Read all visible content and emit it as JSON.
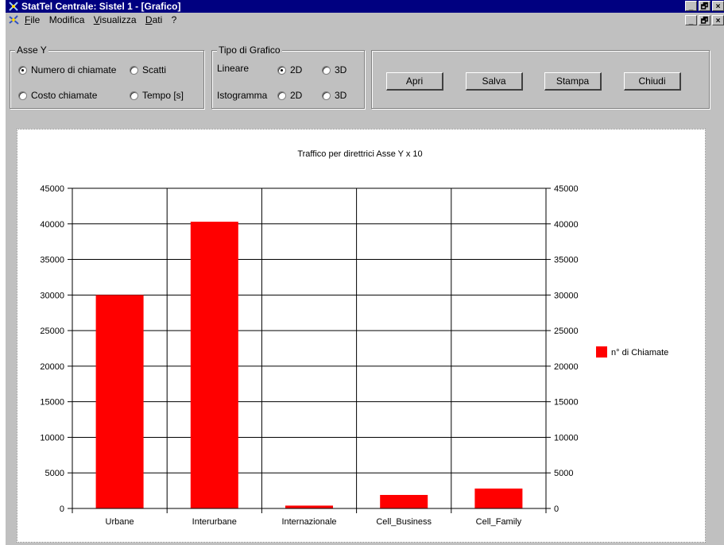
{
  "window": {
    "title": "StatTel Centrale: Sistel 1 - [Grafico]",
    "min_glyph": "_",
    "max_glyph": "🗗",
    "close_glyph": "×"
  },
  "menu": {
    "items": [
      {
        "label": "File",
        "accel": "F",
        "rest": "ile"
      },
      {
        "label": "Modifica",
        "accel": "",
        "rest": "Modifica"
      },
      {
        "label": "Visualizza",
        "accel": "V",
        "rest": "isualizza"
      },
      {
        "label": "Dati",
        "accel": "D",
        "rest": "ati"
      },
      {
        "label": "?",
        "accel": "",
        "rest": "?"
      }
    ]
  },
  "asse_y": {
    "legend": "Asse Y",
    "options": [
      {
        "label": "Numero di chiamate",
        "checked": true
      },
      {
        "label": "Scatti",
        "checked": false
      },
      {
        "label": "Costo chiamate",
        "checked": false
      },
      {
        "label": "Tempo [s]",
        "checked": false
      }
    ]
  },
  "tipo_grafico": {
    "legend": "Tipo di Grafico",
    "lineare_label": "Lineare",
    "istogramma_label": "Istogramma",
    "lineare_2d": "2D",
    "lineare_3d": "3D",
    "istogramma_2d": "2D",
    "istogramma_3d": "3D",
    "selected": "lineare_2d"
  },
  "buttons": {
    "apri": "Apri",
    "salva": "Salva",
    "stampa": "Stampa",
    "chiudi": "Chiudi"
  },
  "colors": {
    "bar": "#ff0000",
    "titlebar": "#000080",
    "face": "#c0c0c0"
  },
  "chart_data": {
    "type": "bar",
    "title": "Traffico per direttrici Asse Y x 10",
    "categories": [
      "Urbane",
      "Interurbane",
      "Internazionale",
      "Cell_Business",
      "Cell_Family"
    ],
    "series": [
      {
        "name": "n° di Chiamate",
        "values": [
          30000,
          40300,
          400,
          1900,
          2800
        ]
      }
    ],
    "ylim": [
      0,
      45000
    ],
    "yticks": [
      0,
      5000,
      10000,
      15000,
      20000,
      25000,
      30000,
      35000,
      40000,
      45000
    ],
    "grid": true,
    "legend_position": "right",
    "secondary_axis": true
  }
}
